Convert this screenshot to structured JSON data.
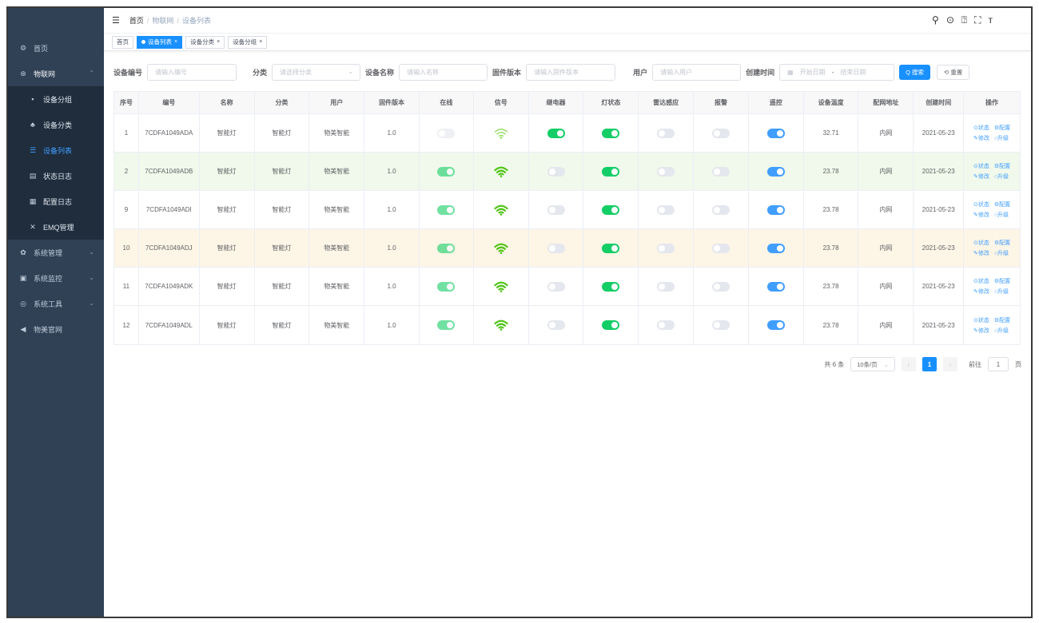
{
  "sidebar": {
    "items": [
      {
        "icon": "dashboard-icon",
        "glyph": "⚙",
        "label": "首页"
      },
      {
        "icon": "iot-icon",
        "glyph": "⊛",
        "label": "物联网",
        "arrow": "⌃"
      }
    ],
    "sub_items": [
      {
        "icon": "grid-icon",
        "glyph": "▪",
        "label": "设备分组"
      },
      {
        "icon": "tree-icon",
        "glyph": "♣",
        "label": "设备分类"
      },
      {
        "icon": "list-icon",
        "glyph": "☰",
        "label": "设备列表"
      },
      {
        "icon": "log-icon",
        "glyph": "▤",
        "label": "状态日志"
      },
      {
        "icon": "config-log-icon",
        "glyph": "▦",
        "label": "配置日志"
      },
      {
        "icon": "emq-icon",
        "glyph": "✕",
        "label": "EMQ管理"
      }
    ],
    "bottom_items": [
      {
        "icon": "gear-icon",
        "glyph": "✿",
        "label": "系统管理",
        "arrow": "⌄"
      },
      {
        "icon": "monitor-icon",
        "glyph": "▣",
        "label": "系统监控",
        "arrow": "⌄"
      },
      {
        "icon": "tool-icon",
        "glyph": "◎",
        "label": "系统工具",
        "arrow": "⌄"
      },
      {
        "icon": "send-icon",
        "glyph": "◀",
        "label": "物美官网"
      }
    ]
  },
  "navbar": {
    "hamburger": "☰",
    "crumbs": [
      "首页",
      "物联网",
      "设备列表"
    ],
    "sep": "/",
    "icons": [
      "⚲",
      "⊙",
      "⍰",
      "⛶",
      "ᴛ"
    ]
  },
  "tags": [
    {
      "label": "首页"
    },
    {
      "label": "设备列表",
      "active": true,
      "x": "×"
    },
    {
      "label": "设备分类",
      "x": "×"
    },
    {
      "label": "设备分组",
      "x": "×"
    }
  ],
  "search": {
    "device_no_label": "设备编号",
    "device_no_placeholder": "请输入编号",
    "category_label": "分类",
    "category_placeholder": "请选择分类",
    "name_label": "设备名称",
    "name_placeholder": "请输入名称",
    "firmware_label": "固件版本",
    "firmware_placeholder": "请输入固件版本",
    "user_label": "用户",
    "user_placeholder": "请输入用户",
    "created_label": "创建时间",
    "start_placeholder": "开始日期",
    "range_sep": "-",
    "end_placeholder": "结束日期",
    "search_btn": "Q 搜索",
    "reset_btn": "⟲ 重置"
  },
  "table": {
    "columns": [
      "序号",
      "编号",
      "名称",
      "分类",
      "用户",
      "固件版本",
      "在线",
      "信号",
      "继电器",
      "灯状态",
      "雷达感应",
      "报警",
      "遥控",
      "设备温度",
      "配网地址",
      "创建时间",
      "操作"
    ],
    "ops": [
      "⊙状态",
      "⚙配置",
      "✎修改",
      "○升级"
    ],
    "rows": [
      {
        "idx": "1",
        "code": "7CDFA1049ADA",
        "name": "智能灯",
        "cat": "智能灯",
        "user": "物美智能",
        "fw": "1.0",
        "online": false,
        "signal": "weak",
        "relay": true,
        "light": true,
        "radar": false,
        "alarm": false,
        "remote": true,
        "temp": "32.71",
        "net": "内网",
        "date": "2021-05-23",
        "style": ""
      },
      {
        "idx": "2",
        "code": "7CDFA1049ADB",
        "name": "智能灯",
        "cat": "智能灯",
        "user": "物美智能",
        "fw": "1.0",
        "online": true,
        "signal": "strong",
        "relay": false,
        "light": true,
        "radar": false,
        "alarm": false,
        "remote": true,
        "temp": "23.78",
        "net": "内网",
        "date": "2021-05-23",
        "style": "success"
      },
      {
        "idx": "9",
        "code": "7CDFA1049ADI",
        "name": "智能灯",
        "cat": "智能灯",
        "user": "物美智能",
        "fw": "1.0",
        "online": true,
        "signal": "strong",
        "relay": false,
        "light": true,
        "radar": false,
        "alarm": false,
        "remote": true,
        "temp": "23.78",
        "net": "内网",
        "date": "2021-05-23",
        "style": ""
      },
      {
        "idx": "10",
        "code": "7CDFA1049ADJ",
        "name": "智能灯",
        "cat": "智能灯",
        "user": "物美智能",
        "fw": "1.0",
        "online": true,
        "signal": "strong",
        "relay": false,
        "light": true,
        "radar": false,
        "alarm": false,
        "remote": true,
        "temp": "23.78",
        "net": "内网",
        "date": "2021-05-23",
        "style": "warning"
      },
      {
        "idx": "11",
        "code": "7CDFA1049ADK",
        "name": "智能灯",
        "cat": "智能灯",
        "user": "物美智能",
        "fw": "1.0",
        "online": true,
        "signal": "strong",
        "relay": false,
        "light": true,
        "radar": false,
        "alarm": false,
        "remote": true,
        "temp": "23.78",
        "net": "内网",
        "date": "2021-05-23",
        "style": ""
      },
      {
        "idx": "12",
        "code": "7CDFA1049ADL",
        "name": "智能灯",
        "cat": "智能灯",
        "user": "物美智能",
        "fw": "1.0",
        "online": true,
        "signal": "strong",
        "relay": false,
        "light": true,
        "radar": false,
        "alarm": false,
        "remote": true,
        "temp": "23.78",
        "net": "内网",
        "date": "2021-05-23",
        "style": ""
      }
    ]
  },
  "pager": {
    "total": "共 6 条",
    "size": "10条/页",
    "prev": "‹",
    "current": "1",
    "next": "›",
    "goto_label": "前往",
    "goto_value": "1",
    "page_unit": "页"
  },
  "colors": {
    "sidebar_bg": "#304156",
    "sidebar_sub_bg": "#1f2d3d",
    "primary": "#1890ff",
    "switch_green": "#13ce66",
    "switch_blue": "#409eff",
    "signal_strong": "#52c41a",
    "signal_weak": "#95de64"
  }
}
